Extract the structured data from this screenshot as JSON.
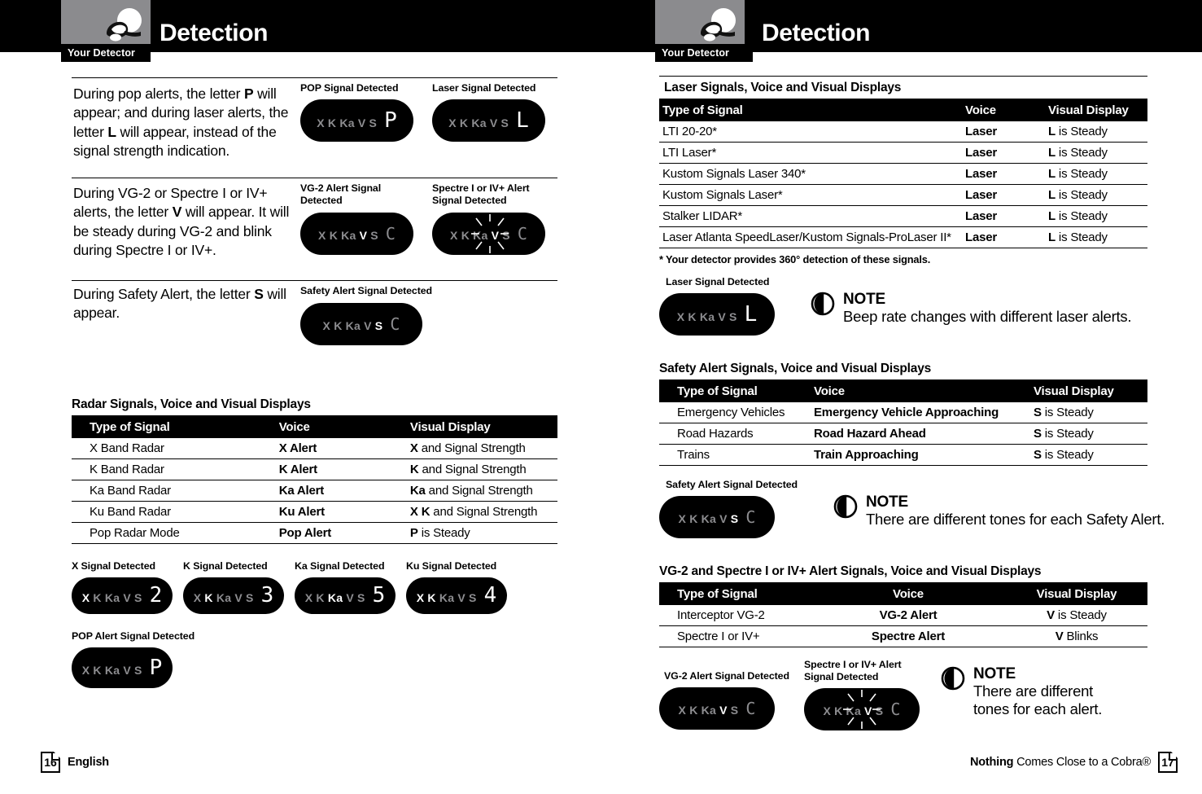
{
  "header": {
    "tab_label": "Your Detector",
    "title": "Detection",
    "logo_icon": "cobra-snake-logo-icon"
  },
  "left_page": {
    "paragraphs": [
      {
        "id": "pop-laser",
        "text_parts": [
          "During pop alerts, the letter ",
          "P",
          " will appear; and during laser alerts, the letter ",
          "L",
          " will appear, instead of the signal strength indication."
        ]
      },
      {
        "id": "vg2-spectre",
        "text_parts": [
          "During VG-2 or Spectre I or IV+ alerts, the letter ",
          "V",
          " will appear. It will be steady during VG-2 and blink during Spectre I or IV+."
        ]
      },
      {
        "id": "safety",
        "text_parts": [
          "During Safety Alert, the letter ",
          "S",
          " will appear."
        ]
      }
    ],
    "displays_row1": [
      {
        "caption": "POP Signal Detected",
        "bands": [
          "X",
          "K",
          "Ka",
          "V",
          "S"
        ],
        "active_band": null,
        "value": "P",
        "value_type": "letter",
        "blink": false
      },
      {
        "caption": "Laser Signal Detected",
        "bands": [
          "X",
          "K",
          "Ka",
          "V",
          "S"
        ],
        "active_band": null,
        "value": "L",
        "value_type": "letter",
        "blink": false
      }
    ],
    "displays_row2": [
      {
        "caption": "VG-2 Alert Signal Detected",
        "bands": [
          "X",
          "K",
          "Ka",
          "V",
          "S"
        ],
        "active_band": "V",
        "value": "C",
        "value_type": "bar",
        "blink": false
      },
      {
        "caption": "Spectre I or IV+ Alert Signal Detected",
        "bands": [
          "X",
          "K",
          "Ka",
          "V",
          "S"
        ],
        "active_band": "V",
        "value": "C",
        "value_type": "bar",
        "blink": true
      }
    ],
    "displays_row3": [
      {
        "caption": "Safety Alert Signal Detected",
        "bands": [
          "X",
          "K",
          "Ka",
          "V",
          "S"
        ],
        "active_band": "S",
        "value": "C",
        "value_type": "bar",
        "blink": false
      }
    ],
    "radar_table": {
      "title": "Radar Signals, Voice and Visual Displays",
      "columns": [
        "Type of Signal",
        "Voice",
        "Visual Display"
      ],
      "rows": [
        {
          "type": "X Band Radar",
          "voice": "X Alert",
          "visual_bold": "X",
          "visual_rest": " and Signal Strength"
        },
        {
          "type": "K Band Radar",
          "voice": "K Alert",
          "visual_bold": "K",
          "visual_rest": " and Signal Strength"
        },
        {
          "type": "Ka Band Radar",
          "voice": "Ka Alert",
          "visual_bold": "Ka",
          "visual_rest": " and Signal Strength"
        },
        {
          "type": "Ku Band Radar",
          "voice": "Ku Alert",
          "visual_bold": "X K",
          "visual_rest": " and Signal Strength"
        },
        {
          "type": "Pop Radar Mode",
          "voice": "Pop Alert",
          "visual_bold": "P",
          "visual_rest": " is Steady"
        }
      ]
    },
    "displays_row4": [
      {
        "caption": "X Signal Detected",
        "bands": [
          "X",
          "K",
          "Ka",
          "V",
          "S"
        ],
        "active_band": "X",
        "value": "2",
        "value_type": "digit",
        "blink": false
      },
      {
        "caption": "K Signal Detected",
        "bands": [
          "X",
          "K",
          "Ka",
          "V",
          "S"
        ],
        "active_band": "K",
        "value": "3",
        "value_type": "digit",
        "blink": false
      },
      {
        "caption": "Ka Signal Detected",
        "bands": [
          "X",
          "K",
          "Ka",
          "V",
          "S"
        ],
        "active_band": "Ka",
        "value": "5",
        "value_type": "digit",
        "blink": false
      },
      {
        "caption": "Ku Signal Detected",
        "bands": [
          "X",
          "K",
          "Ka",
          "V",
          "S"
        ],
        "active_band": "XK",
        "value": "4",
        "value_type": "digit",
        "blink": false
      }
    ],
    "displays_row5": [
      {
        "caption": "POP Alert Signal Detected",
        "bands": [
          "X",
          "K",
          "Ka",
          "V",
          "S"
        ],
        "active_band": null,
        "value": "P",
        "value_type": "letter",
        "blink": false
      }
    ],
    "footer": {
      "page_number": "16",
      "label": "English"
    }
  },
  "right_page": {
    "laser_table": {
      "title": "Laser Signals, Voice and Visual Displays",
      "columns": [
        "Type of Signal",
        "Voice",
        "Visual Display"
      ],
      "rows": [
        {
          "type": "LTI 20-20*",
          "voice": "Laser",
          "visual_bold": "L",
          "visual_rest": " is Steady"
        },
        {
          "type": "LTI Laser*",
          "voice": "Laser",
          "visual_bold": "L",
          "visual_rest": " is Steady"
        },
        {
          "type": "Kustom Signals Laser 340*",
          "voice": "Laser",
          "visual_bold": "L",
          "visual_rest": " is Steady"
        },
        {
          "type": "Kustom Signals Laser*",
          "voice": "Laser",
          "visual_bold": "L",
          "visual_rest": " is Steady"
        },
        {
          "type": "Stalker LIDAR*",
          "voice": "Laser",
          "visual_bold": "L",
          "visual_rest": " is Steady"
        },
        {
          "type": "Laser Atlanta SpeedLaser/Kustom Signals-ProLaser II*",
          "voice": "Laser",
          "visual_bold": "L",
          "visual_rest": " is Steady"
        }
      ],
      "footnote": "* Your detector provides 360° detection of these signals."
    },
    "laser_display": {
      "caption": "Laser Signal Detected",
      "bands": [
        "X",
        "K",
        "Ka",
        "V",
        "S"
      ],
      "active_band": null,
      "value": "L",
      "value_type": "letter",
      "blink": false
    },
    "laser_note": {
      "icon": "note-bell-icon",
      "heading": "NOTE",
      "body": "Beep rate changes with different laser alerts."
    },
    "safety_table": {
      "title": "Safety Alert Signals, Voice and Visual Displays",
      "columns": [
        "Type of Signal",
        "Voice",
        "Visual Display"
      ],
      "rows": [
        {
          "type": "Emergency Vehicles",
          "voice": "Emergency Vehicle Approaching",
          "visual_bold": "S",
          "visual_rest": " is Steady"
        },
        {
          "type": "Road Hazards",
          "voice": "Road Hazard Ahead",
          "visual_bold": "S",
          "visual_rest": " is Steady"
        },
        {
          "type": "Trains",
          "voice": "Train Approaching",
          "visual_bold": "S",
          "visual_rest": " is Steady"
        }
      ]
    },
    "safety_display": {
      "caption": "Safety Alert Signal Detected",
      "bands": [
        "X",
        "K",
        "Ka",
        "V",
        "S"
      ],
      "active_band": "S",
      "value": "C",
      "value_type": "bar",
      "blink": false
    },
    "safety_note": {
      "icon": "note-bell-icon",
      "heading": "NOTE",
      "body": "There are different tones for each Safety Alert."
    },
    "vg2_table": {
      "title": "VG-2 and Spectre I or IV+ Alert Signals, Voice and Visual Displays",
      "columns": [
        "Type of Signal",
        "Voice",
        "Visual Display"
      ],
      "rows": [
        {
          "type": "Interceptor VG-2",
          "voice": "VG-2 Alert",
          "visual_bold": "V",
          "visual_rest": " is Steady"
        },
        {
          "type": "Spectre I or IV+",
          "voice": "Spectre Alert",
          "visual_bold": "V",
          "visual_rest": " Blinks"
        }
      ]
    },
    "vg2_displays": [
      {
        "caption": "VG-2 Alert Signal Detected",
        "bands": [
          "X",
          "K",
          "Ka",
          "V",
          "S"
        ],
        "active_band": "V",
        "value": "C",
        "value_type": "bar",
        "blink": false
      },
      {
        "caption": "Spectre I or IV+ Alert Signal Detected",
        "bands": [
          "X",
          "K",
          "Ka",
          "V",
          "S"
        ],
        "active_band": "V",
        "value": "C",
        "value_type": "bar",
        "blink": true
      }
    ],
    "vg2_note": {
      "icon": "note-bell-icon",
      "heading": "NOTE",
      "body": "There are different\ntones for each alert."
    },
    "footer": {
      "page_number": "17",
      "tagline_bold": "Nothing",
      "tagline_rest": " Comes Close to a Cobra®"
    }
  }
}
